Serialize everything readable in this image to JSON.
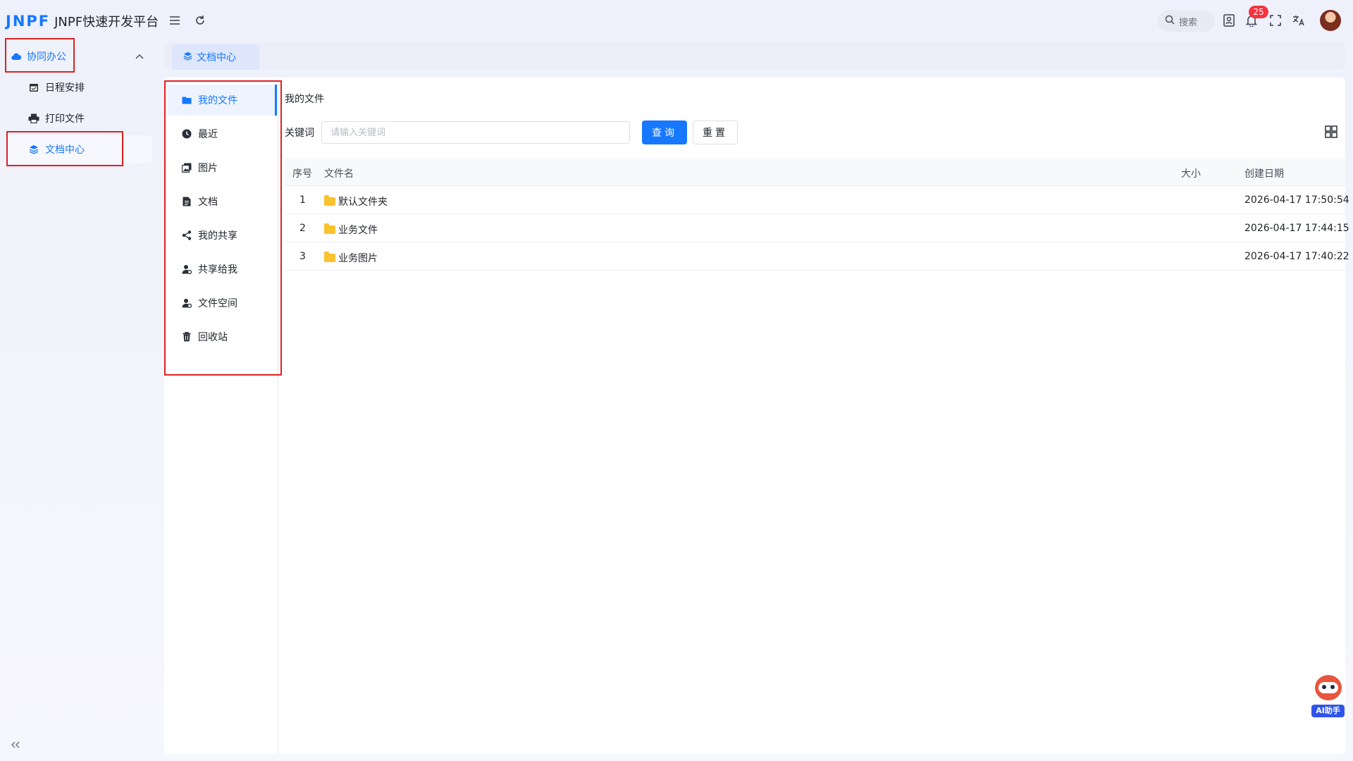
{
  "app": {
    "logo_mark": "JNPF",
    "title": "JNPF快速开发平台"
  },
  "header": {
    "search_label": "搜索",
    "notification_count": "25"
  },
  "nav": {
    "group_label": "协同办公",
    "items": [
      {
        "label": "日程安排",
        "icon": "calendar-icon"
      },
      {
        "label": "打印文件",
        "icon": "printer-icon"
      },
      {
        "label": "文档中心",
        "icon": "layers-icon",
        "active": true
      }
    ]
  },
  "tabs": [
    {
      "label": "文档中心",
      "active": true
    }
  ],
  "side_menu": [
    {
      "label": "我的文件",
      "icon": "folder-icon",
      "active": true
    },
    {
      "label": "最近",
      "icon": "clock-icon"
    },
    {
      "label": "图片",
      "icon": "image-icon"
    },
    {
      "label": "文档",
      "icon": "document-icon"
    },
    {
      "label": "我的共享",
      "icon": "share-icon"
    },
    {
      "label": "共享给我",
      "icon": "user-share-icon"
    },
    {
      "label": "文件空间",
      "icon": "user-space-icon"
    },
    {
      "label": "回收站",
      "icon": "trash-icon"
    }
  ],
  "main": {
    "breadcrumb": "我的文件",
    "keyword_label": "关键词",
    "keyword_placeholder": "请输入关键词",
    "query_button": "查询",
    "reset_button": "重置"
  },
  "table": {
    "columns": {
      "index": "序号",
      "name": "文件名",
      "size": "大小",
      "created": "创建日期"
    },
    "rows": [
      {
        "index": "1",
        "name": "默认文件夹",
        "size": "",
        "created": "2026-04-17 17:50:54"
      },
      {
        "index": "2",
        "name": "业务文件",
        "size": "",
        "created": "2026-04-17 17:44:15"
      },
      {
        "index": "3",
        "name": "业务图片",
        "size": "",
        "created": "2026-04-17 17:40:22"
      }
    ]
  },
  "assistant": {
    "label": "AI助手"
  },
  "colors": {
    "primary": "#1677ff",
    "highlight_border": "#e02020",
    "badge": "#f5333f",
    "folder": "#f9c22e"
  }
}
